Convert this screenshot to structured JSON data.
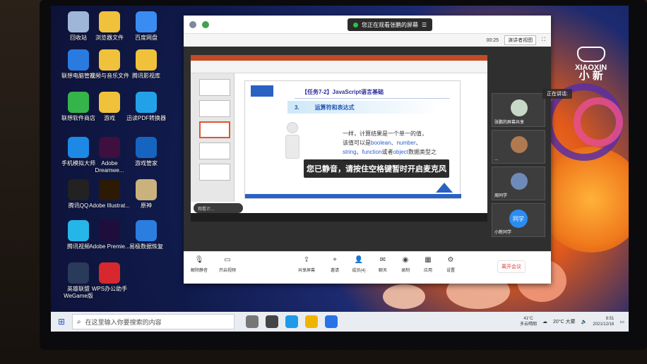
{
  "desktop_icons": [
    {
      "label": "回收站",
      "icon": "recycle-bin-icon",
      "color": "#9fb6d8"
    },
    {
      "label": "浏览器文件",
      "icon": "browser-file-icon",
      "color": "#f0c23c"
    },
    {
      "label": "百度网盘",
      "icon": "baidu-netdisk-icon",
      "color": "#3b8cf2"
    },
    {
      "label": "联想电脑管家",
      "icon": "lenovo-manager-icon",
      "color": "#2a7be0"
    },
    {
      "label": "视频与音乐文件",
      "icon": "media-folder-icon",
      "color": "#f0c23c"
    },
    {
      "label": "腾讯影视库",
      "icon": "tencent-video-lib-icon",
      "color": "#f0c23c"
    },
    {
      "label": "联想软件商店",
      "icon": "lenovo-store-icon",
      "color": "#35b44a"
    },
    {
      "label": "游戏",
      "icon": "games-folder-icon",
      "color": "#f0c23c"
    },
    {
      "label": "迅读PDF转换器",
      "icon": "pdf-converter-icon",
      "color": "#23a1e8"
    },
    {
      "label": "手机模拟大师",
      "icon": "phone-emulator-icon",
      "color": "#1e88e5"
    },
    {
      "label": "Adobe Dreamwe...",
      "icon": "dreamweaver-icon",
      "color": "#3e0f3f"
    },
    {
      "label": "游戏管家",
      "icon": "game-manager-icon",
      "color": "#1565c0"
    },
    {
      "label": "腾讯QQ",
      "icon": "qq-icon",
      "color": "#222222"
    },
    {
      "label": "Adobe Illustrat...",
      "icon": "illustrator-icon",
      "color": "#2d1a05"
    },
    {
      "label": "原神",
      "icon": "genshin-icon",
      "color": "#c9b27d"
    },
    {
      "label": "腾讯视频",
      "icon": "tencent-video-icon",
      "color": "#26b5e8"
    },
    {
      "label": "Adobe Premie...",
      "icon": "premiere-icon",
      "color": "#1f0d3b"
    },
    {
      "label": "易极数据恢复",
      "icon": "data-recovery-icon",
      "color": "#2b7de0"
    },
    {
      "label": "英雄联盟 WeGame版",
      "icon": "league-icon",
      "color": "#2a3a5a"
    },
    {
      "label": "WPS办公助手",
      "icon": "wps-icon",
      "color": "#d7282f"
    }
  ],
  "wallpaper": {
    "logo_top": "XIAOXIN",
    "logo_bottom": "小 新"
  },
  "meeting": {
    "share_banner": "您正在观看张鹏的屏幕",
    "layout_button": "演讲者视图",
    "time_label": "00:25",
    "slide": {
      "title": "【任务7-2】JavaScript语言基础",
      "section_number": "3.",
      "section_title": "运算符和表达式",
      "body_line1": "一样，计算结果是一个单一的值，",
      "body_line2_prefix": "该值可以是",
      "kw_boolean": "boolean",
      "kw_number": "number",
      "kw_string": "string",
      "kw_function": "function",
      "body_or": "或者",
      "kw_object": "object",
      "body_suffix": "数据类型之一。"
    },
    "notes_hint": "观看计...",
    "toast": "您已静音，请按住空格键暂时开启麦克风",
    "participants": [
      {
        "name": "张鹏的屏幕共享",
        "avatar_color": "#c8d8c8"
      },
      {
        "name": "...",
        "avatar_color": "#b07a50"
      },
      {
        "name": "周同学",
        "avatar_color": "#6e8ab8"
      },
      {
        "name": "小新同学",
        "avatar_text": "同学",
        "avatar_color": "#2b8cf0"
      }
    ],
    "controls": [
      {
        "label": "解除静音",
        "icon": "mic-muted-icon"
      },
      {
        "label": "开启视频",
        "icon": "camera-off-icon"
      },
      {
        "label": "共享屏幕",
        "icon": "share-screen-icon"
      },
      {
        "label": "邀请",
        "icon": "invite-icon"
      },
      {
        "label": "成员(4)",
        "icon": "members-icon"
      },
      {
        "label": "聊天",
        "icon": "chat-icon"
      },
      {
        "label": "录制",
        "icon": "record-icon"
      },
      {
        "label": "应用",
        "icon": "apps-icon"
      },
      {
        "label": "设置",
        "icon": "settings-icon"
      }
    ],
    "end_button": "离开会议"
  },
  "side_pill": "正在讲话:",
  "taskbar": {
    "search_placeholder": "在这里输入你要搜索的内容",
    "weather_temp": "41°C",
    "weather_desc": "多云晴朗",
    "tray_temp": "20°C 大雾",
    "time": "8:51",
    "date": "2021/12/16"
  }
}
